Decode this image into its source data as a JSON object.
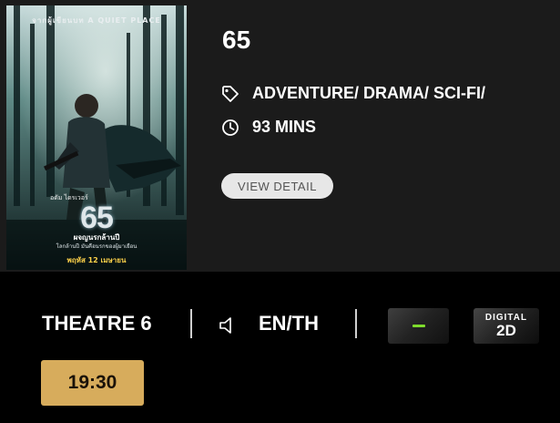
{
  "movie": {
    "title": "65",
    "genres": "ADVENTURE/ DRAMA/ SCI-FI/",
    "duration": "93 MINS",
    "view_detail_label": "VIEW DETAIL",
    "genre_icon": "tag-icon",
    "duration_icon": "clock-icon"
  },
  "poster": {
    "tagline": "จากผู้เขียนบท A QUIET PLACE",
    "actor": "อดัม ไดรเวอร์",
    "logo": "65",
    "subtitle": "ผจญนรกล้านปี",
    "tagline2": "โลกล้านปี มันคือนรกของผู้มาเยือน",
    "release": "พฤหัส 12 เมษายน"
  },
  "session": {
    "theatre": "THEATRE 6",
    "audio_icon": "speaker-icon",
    "language": "EN/TH",
    "format_badge_1": "rating-badge",
    "format_badge_2_top": "DIGITAL",
    "format_badge_2_main": "2D",
    "showtimes": [
      "19:30"
    ]
  },
  "colors": {
    "card_bg": "#1b1b1b",
    "page_bg": "#000000",
    "showtime_bg": "#d7ac5c",
    "button_bg": "#e7e7e7",
    "rating_accent": "#7edc2c"
  }
}
